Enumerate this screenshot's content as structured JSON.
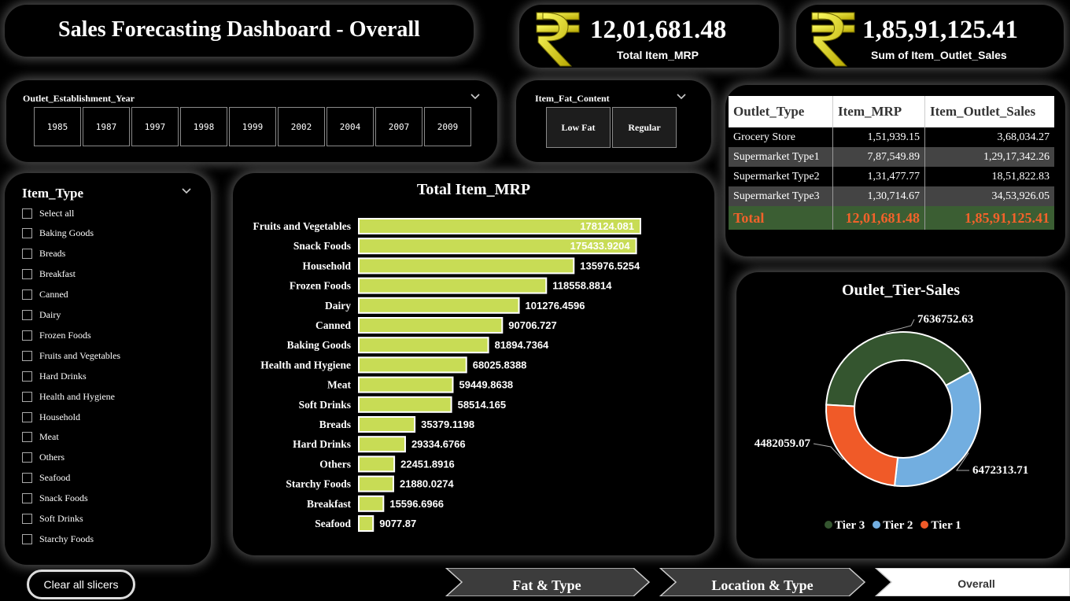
{
  "title": "Sales Forecasting Dashboard - Overall",
  "kpis": [
    {
      "value": "12,01,681.48",
      "label": "Total Item_MRP",
      "icon": "rupee-icon"
    },
    {
      "value": "1,85,91,125.41",
      "label": "Sum of Item_Outlet_Sales",
      "icon": "rupee-icon"
    }
  ],
  "year_slicer": {
    "title": "Outlet_Establishment_Year",
    "options": [
      "1985",
      "1987",
      "1997",
      "1998",
      "1999",
      "2002",
      "2004",
      "2007",
      "2009"
    ]
  },
  "fat_slicer": {
    "title": "Item_Fat_Content",
    "options": [
      "Low Fat",
      "Regular"
    ]
  },
  "outlet_table": {
    "headers": [
      "Outlet_Type",
      "Item_MRP",
      "Item_Outlet_Sales"
    ],
    "rows": [
      [
        "Grocery Store",
        "1,51,939.15",
        "3,68,034.27"
      ],
      [
        "Supermarket Type1",
        "7,87,549.89",
        "1,29,17,342.26"
      ],
      [
        "Supermarket Type2",
        "1,31,477.77",
        "18,51,822.83"
      ],
      [
        "Supermarket Type3",
        "1,30,714.67",
        "34,53,926.05"
      ]
    ],
    "total": [
      "Total",
      "12,01,681.48",
      "1,85,91,125.41"
    ]
  },
  "item_type_slicer": {
    "title": "Item_Type",
    "options": [
      "Select all",
      "Baking Goods",
      "Breads",
      "Breakfast",
      "Canned",
      "Dairy",
      "Frozen Foods",
      "Fruits and Vegetables",
      "Hard Drinks",
      "Health and Hygiene",
      "Household",
      "Meat",
      "Others",
      "Seafood",
      "Snack Foods",
      "Soft Drinks",
      "Starchy Foods"
    ]
  },
  "chart_data": [
    {
      "type": "bar",
      "orientation": "horizontal",
      "title": "Total Item_MRP",
      "categories": [
        "Fruits and Vegetables",
        "Snack Foods",
        "Household",
        "Frozen Foods",
        "Dairy",
        "Canned",
        "Baking Goods",
        "Health and Hygiene",
        "Meat",
        "Soft Drinks",
        "Breads",
        "Hard Drinks",
        "Others",
        "Starchy Foods",
        "Breakfast",
        "Seafood"
      ],
      "values": [
        178124.081,
        175433.9204,
        135976.5254,
        118558.8814,
        101276.4596,
        90706.727,
        81894.7364,
        68025.8388,
        59449.8638,
        58514.165,
        35379.1198,
        29334.6766,
        22451.8916,
        21880.0274,
        15596.6966,
        9077.87
      ],
      "labels": [
        "178124.081",
        "175433.9204",
        "135976.5254",
        "118558.8814",
        "101276.4596",
        "90706.727",
        "81894.7364",
        "68025.8388",
        "59449.8638",
        "58514.165",
        "35379.1198",
        "29334.6766",
        "22451.8916",
        "21880.0274",
        "15596.6966",
        "9077.87"
      ],
      "color": "#c8dc55",
      "xlim": [
        0,
        178124.081
      ]
    },
    {
      "type": "pie",
      "donut": true,
      "title": "Outlet_Tier-Sales",
      "categories": [
        "Tier 3",
        "Tier 2",
        "Tier 1"
      ],
      "values": [
        7636752.63,
        6472313.71,
        4482059.07
      ],
      "labels": [
        "7636752.63",
        "6472313.71",
        "4482059.07"
      ],
      "colors": [
        "#34552f",
        "#72aee0",
        "#f05a28"
      ],
      "legend_position": "bottom"
    }
  ],
  "bottom": {
    "clear_label": "Clear all slicers",
    "nav": [
      "Fat & Type",
      "Location & Type",
      "Overall"
    ]
  }
}
